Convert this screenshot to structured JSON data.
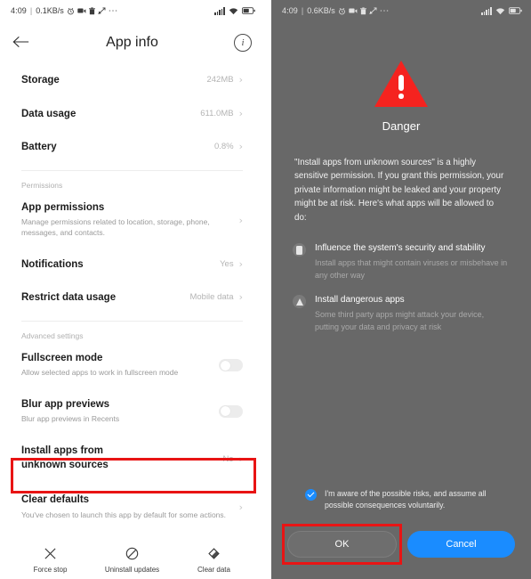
{
  "left_panel": {
    "status_bar": {
      "time": "4:09",
      "separator": "|",
      "network_speed": "0.1KB/s",
      "icons": [
        "alarm-icon",
        "video-recorder-icon",
        "trash-icon",
        "share-icon",
        "more-icon"
      ],
      "right_icons": [
        "signal-icon",
        "wifi-icon",
        "battery-icon"
      ]
    },
    "appbar": {
      "back_icon": "back-arrow-icon",
      "title": "App info",
      "info_icon": "info-icon",
      "info_glyph": "i"
    },
    "rows": [
      {
        "title": "Storage",
        "subtitle": "",
        "value": "242MB",
        "chevron": "›"
      },
      {
        "title": "Data usage",
        "subtitle": "",
        "value": "611.0MB",
        "chevron": "›"
      },
      {
        "title": "Battery",
        "subtitle": "",
        "value": "0.8%",
        "chevron": "›"
      }
    ],
    "section_permissions": "Permissions",
    "permission_rows": [
      {
        "title": "App permissions",
        "subtitle": "Manage permissions related to location, storage, phone, messages, and contacts.",
        "value": "",
        "chevron": "›"
      },
      {
        "title": "Notifications",
        "subtitle": "",
        "value": "Yes",
        "chevron": "›"
      },
      {
        "title": "Restrict data usage",
        "subtitle": "",
        "value": "Mobile data",
        "chevron": "›"
      }
    ],
    "section_advanced": "Advanced settings",
    "advanced_rows": [
      {
        "title": "Fullscreen mode",
        "subtitle": "Allow selected apps to work in fullscreen mode",
        "control": "toggle",
        "toggle_on": false
      },
      {
        "title": "Blur app previews",
        "subtitle": "Blur app previews in Recents",
        "control": "toggle",
        "toggle_on": false
      }
    ],
    "highlighted_row": {
      "title_line1": "Install apps from",
      "title_line2": "unknown sources",
      "value": "No",
      "chevron": "›"
    },
    "clear_defaults_row": {
      "title": "Clear defaults",
      "subtitle": "You've chosen to launch this app by default for some actions.",
      "chevron": "›"
    },
    "bottom_actions": [
      {
        "icon": "close-x-icon",
        "label": "Force stop",
        "glyph": "✕"
      },
      {
        "icon": "no-entry-icon",
        "label": "Uninstall updates",
        "glyph": "⊘"
      },
      {
        "icon": "eraser-icon",
        "label": "Clear data",
        "glyph": "◇"
      }
    ]
  },
  "right_panel": {
    "status_bar": {
      "time": "4:09",
      "separator": "|",
      "network_speed": "0.6KB/s",
      "icons": [
        "alarm-icon",
        "video-recorder-icon",
        "trash-icon",
        "share-icon",
        "more-icon"
      ],
      "right_icons": [
        "signal-icon",
        "wifi-icon",
        "battery-icon"
      ]
    },
    "hero": {
      "icon": "danger-triangle-icon",
      "title": "Danger"
    },
    "body_text": "\"Install apps from unknown sources\" is a highly sensitive permission. If you grant this permission, your private information might be leaked and your property might be at risk. Here's what apps will be allowed to do:",
    "bullets": [
      {
        "icon": "device-security-icon",
        "heading": "Influence the system's security and stability",
        "description": "Install apps that might contain viruses or misbehave in any other way"
      },
      {
        "icon": "warning-triangle-icon",
        "heading": "Install dangerous apps",
        "description": "Some third party apps might attack your device, putting your data and privacy at risk"
      }
    ],
    "consent": {
      "checked": true,
      "text": "I'm aware of the possible risks, and assume all possible consequences voluntarily."
    },
    "buttons": {
      "ok_label": "OK",
      "cancel_label": "Cancel"
    }
  },
  "colors": {
    "danger_red": "#f5231f",
    "highlight_red": "#e81414",
    "accent_blue": "#1a8cff",
    "dialog_bg": "#686868",
    "panel_bg": "#ffffff"
  }
}
